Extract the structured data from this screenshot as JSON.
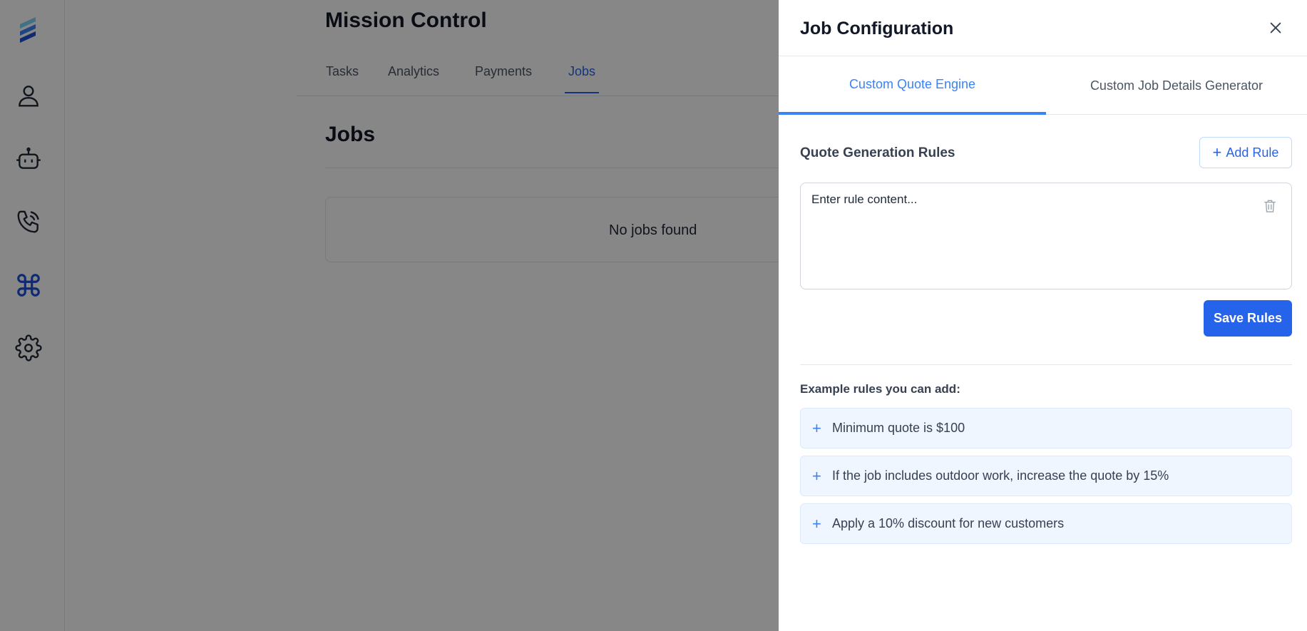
{
  "app": {
    "page_title": "Mission Control",
    "tabs": [
      {
        "label": "Tasks"
      },
      {
        "label": "Analytics"
      },
      {
        "label": "Payments"
      },
      {
        "label": "Jobs"
      }
    ],
    "active_tab": "Jobs",
    "section_title": "Jobs",
    "empty_message": "No jobs found"
  },
  "sidebar": {
    "items": [
      {
        "icon": "user-icon"
      },
      {
        "icon": "robot-icon"
      },
      {
        "icon": "phone-icon"
      },
      {
        "icon": "command-icon",
        "active": true
      },
      {
        "icon": "gear-icon"
      }
    ]
  },
  "drawer": {
    "title": "Job Configuration",
    "tabs": [
      {
        "label": "Custom Quote Engine"
      },
      {
        "label": "Custom Job Details Generator"
      }
    ],
    "active_tab": "Custom Quote Engine",
    "rules_heading": "Quote Generation Rules",
    "add_rule_label": "Add Rule",
    "rule_placeholder": "Enter rule content...",
    "save_label": "Save Rules",
    "examples_heading": "Example rules you can add:",
    "examples": [
      {
        "text": "Minimum quote is $100"
      },
      {
        "text": "If the job includes outdoor work, increase the quote by 15%"
      },
      {
        "text": "Apply a 10% discount for new customers"
      }
    ]
  },
  "colors": {
    "accent": "#2563eb",
    "accent_light": "#3b82f6",
    "overlay": "rgba(0,0,0,0.47)",
    "example_bg": "#eff6ff"
  }
}
